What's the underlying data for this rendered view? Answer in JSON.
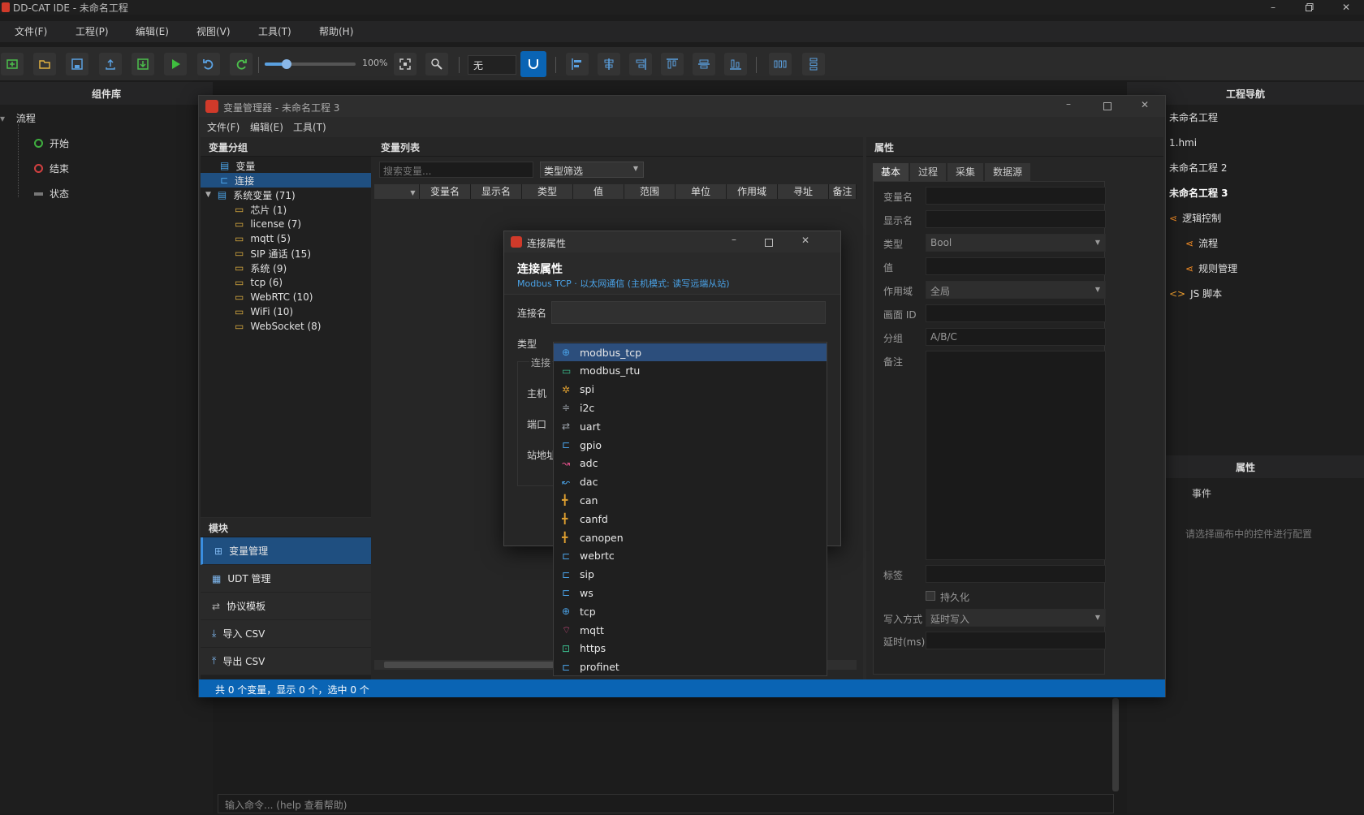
{
  "window": {
    "title": "DD-CAT IDE - 未命名工程"
  },
  "menu": [
    "文件(F)",
    "工程(P)",
    "编辑(E)",
    "视图(V)",
    "工具(T)",
    "帮助(H)"
  ],
  "toolbar": {
    "zoom": "100%",
    "layer_value": "无",
    "slider_fraction": 0.24
  },
  "component_library": {
    "title": "组件库",
    "root": "流程",
    "items": [
      "开始",
      "结束",
      "状态"
    ]
  },
  "var_manager": {
    "title": "变量管理器 - 未命名工程 3",
    "menu": [
      "文件(F)",
      "编辑(E)",
      "工具(T)"
    ],
    "groups_title": "变量分组",
    "groups": [
      {
        "label": "变量",
        "level": 1
      },
      {
        "label": "连接",
        "level": 1,
        "selected": true
      },
      {
        "label": "系统变量 (71)",
        "level": 1,
        "expanded": true
      },
      {
        "label": "芯片 (1)",
        "level": 2
      },
      {
        "label": "license (7)",
        "level": 2
      },
      {
        "label": "mqtt (5)",
        "level": 2
      },
      {
        "label": "SIP 通话 (15)",
        "level": 2
      },
      {
        "label": "系统 (9)",
        "level": 2
      },
      {
        "label": "tcp (6)",
        "level": 2
      },
      {
        "label": "WebRTC (10)",
        "level": 2
      },
      {
        "label": "WiFi (10)",
        "level": 2
      },
      {
        "label": "WebSocket (8)",
        "level": 2
      }
    ],
    "modules_title": "模块",
    "modules": [
      {
        "label": "变量管理",
        "icon": "grid-icon",
        "active": true
      },
      {
        "label": "UDT 管理",
        "icon": "table-icon"
      },
      {
        "label": "协议模板",
        "icon": "swap-icon"
      },
      {
        "label": "导入 CSV",
        "icon": "import-icon"
      },
      {
        "label": "导出 CSV",
        "icon": "export-icon"
      }
    ],
    "list_title": "变量列表",
    "search_placeholder": "搜索变量...",
    "type_filter": "类型筛选",
    "columns": [
      "变量名",
      "显示名",
      "类型",
      "值",
      "范围",
      "单位",
      "作用域",
      "寻址",
      "备注"
    ],
    "status": "共 0 个变量，显示 0 个，选中 0 个",
    "props_title": "属性",
    "props_tabs": [
      "基本",
      "过程",
      "采集",
      "数据源"
    ],
    "props": {
      "var_name_label": "变量名",
      "display_label": "显示名",
      "type_label": "类型",
      "type_value": "Bool",
      "value_label": "值",
      "scope_label": "作用域",
      "scope_value": "全局",
      "screen_label": "画面 ID",
      "group_label": "分组",
      "group_placeholder": "A/B/C",
      "remark_label": "备注",
      "tag_label": "标签",
      "persist_label": "持久化",
      "write_label": "写入方式",
      "write_value": "延时写入",
      "delay_label": "延时(ms)"
    }
  },
  "dialog": {
    "title": "连接属性",
    "heading": "连接属性",
    "subtitle": "Modbus TCP · 以太网通信 (主机模式: 读写远端从站)",
    "name_label": "连接名",
    "type_label": "类型",
    "group_label": "连接",
    "host_label": "主机",
    "port_label": "端口",
    "station_label": "站地址"
  },
  "dropdown": [
    {
      "label": "modbus_tcp",
      "icon": "globe-icon",
      "color": "#4aa3e8",
      "selected": true
    },
    {
      "label": "modbus_rtu",
      "icon": "serial-icon",
      "color": "#3bbf8f"
    },
    {
      "label": "spi",
      "icon": "chip-icon",
      "color": "#e0a030"
    },
    {
      "label": "i2c",
      "icon": "bus-icon",
      "color": "#9aa0a8"
    },
    {
      "label": "uart",
      "icon": "arrows-icon",
      "color": "#9aa0a8"
    },
    {
      "label": "gpio",
      "icon": "plug-icon",
      "color": "#4aa3e8"
    },
    {
      "label": "adc",
      "icon": "analog-icon",
      "color": "#e0508a"
    },
    {
      "label": "dac",
      "icon": "analog-out-icon",
      "color": "#4aa3e8"
    },
    {
      "label": "can",
      "icon": "network-icon",
      "color": "#e0a030"
    },
    {
      "label": "canfd",
      "icon": "network-icon",
      "color": "#e0a030"
    },
    {
      "label": "canopen",
      "icon": "network-icon",
      "color": "#e0a030"
    },
    {
      "label": "webrtc",
      "icon": "plug-icon",
      "color": "#4aa3e8"
    },
    {
      "label": "sip",
      "icon": "plug-icon",
      "color": "#4aa3e8"
    },
    {
      "label": "ws",
      "icon": "plug-icon",
      "color": "#4aa3e8"
    },
    {
      "label": "tcp",
      "icon": "globe-icon",
      "color": "#4aa3e8"
    },
    {
      "label": "mqtt",
      "icon": "wifi-icon",
      "color": "#e0508a"
    },
    {
      "label": "https",
      "icon": "lock-icon",
      "color": "#3bbf8f"
    },
    {
      "label": "profinet",
      "icon": "plug-icon",
      "color": "#4aa3e8"
    }
  ],
  "project_nav": {
    "title": "工程导航",
    "items": [
      {
        "label": "未命名工程",
        "bold": false,
        "indent": 0
      },
      {
        "label": "1.hmi",
        "bold": false,
        "indent": 0
      },
      {
        "label": "未命名工程 2",
        "bold": false,
        "indent": 0
      },
      {
        "label": "未命名工程 3",
        "bold": true,
        "indent": 0
      },
      {
        "label": "逻辑控制",
        "icon": "share-icon",
        "indent": 0
      },
      {
        "label": "流程",
        "icon": "share-icon",
        "indent": 1
      },
      {
        "label": "规则管理",
        "icon": "share-icon",
        "indent": 1
      },
      {
        "label": "JS 脚本",
        "icon": "code-icon",
        "indent": 0
      }
    ]
  },
  "right_props": {
    "title": "属性",
    "tab": "事件",
    "hint": "请选择画布中的控件进行配置"
  },
  "console": {
    "placeholder": "输入命令... (help 查看帮助)",
    "prompt": ">"
  },
  "colors": {
    "accent": "#0a64b4",
    "selected": "#2c4e7c",
    "bg": "#1e1e1e"
  }
}
